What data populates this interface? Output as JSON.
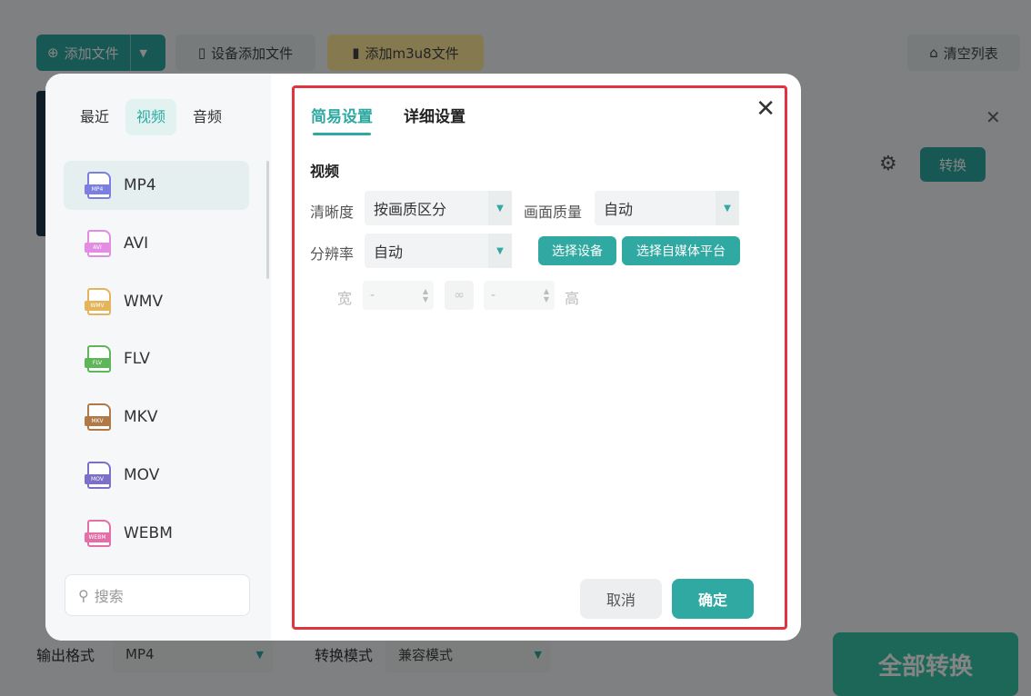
{
  "background": {
    "toolbar": {
      "add_file": "添加文件",
      "device_add": "设备添加文件",
      "add_m3u8": "添加m3u8文件",
      "clear_list": "清空列表"
    },
    "item_convert": "转换",
    "footer": {
      "output_format_label": "输出格式",
      "output_format_value": "MP4",
      "convert_mode_label": "转换模式",
      "convert_mode_value": "兼容模式",
      "convert_all": "全部转换"
    }
  },
  "dialog": {
    "categories": [
      {
        "label": "最近"
      },
      {
        "label": "视频"
      },
      {
        "label": "音频"
      }
    ],
    "active_category": "视频",
    "formats": [
      {
        "label": "MP4",
        "tag": "MP4",
        "color": "#7b7fe0"
      },
      {
        "label": "AVI",
        "tag": "AVI",
        "color": "#e48be4"
      },
      {
        "label": "WMV",
        "tag": "WMV",
        "color": "#e4b35a"
      },
      {
        "label": "FLV",
        "tag": "FLV",
        "color": "#5fb65a"
      },
      {
        "label": "MKV",
        "tag": "MKV",
        "color": "#b07a48"
      },
      {
        "label": "MOV",
        "tag": "MOV",
        "color": "#7b6fc9"
      },
      {
        "label": "WEBM",
        "tag": "WEBM",
        "color": "#e46fa8"
      }
    ],
    "selected_format": "MP4",
    "search_placeholder": "搜索",
    "settings": {
      "tabs": [
        "简易设置",
        "详细设置"
      ],
      "active_tab": "简易设置",
      "section_title": "视频",
      "clarity_label": "清晰度",
      "clarity_value": "按画质区分",
      "quality_label": "画面质量",
      "quality_value": "自动",
      "resolution_label": "分辨率",
      "resolution_value": "自动",
      "select_device": "选择设备",
      "select_platform": "选择自媒体平台",
      "width_label": "宽",
      "width_value": "-",
      "height_label": "高",
      "height_value": "-"
    },
    "cancel": "取消",
    "confirm": "确定"
  },
  "colors": {
    "accent": "#2fa9a2",
    "highlight_border": "#e0343f"
  }
}
